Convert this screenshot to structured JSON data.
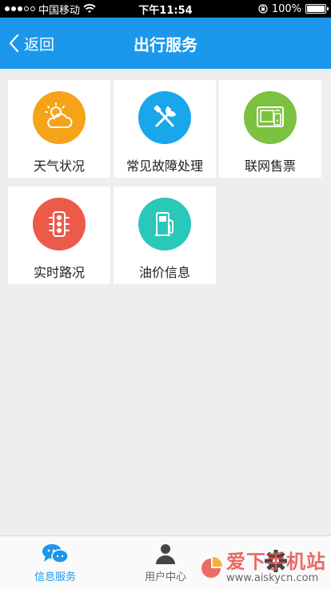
{
  "status_bar": {
    "carrier": "中国移动",
    "time": "下午11:54",
    "battery": "100%",
    "battery_level": 1.0
  },
  "nav": {
    "back_label": "返回",
    "title": "出行服务"
  },
  "tiles": [
    {
      "label": "天气状况",
      "icon": "weather-icon",
      "color": "#f5a319"
    },
    {
      "label": "常见故障处理",
      "icon": "tools-icon",
      "color": "#1aa6ea"
    },
    {
      "label": "联网售票",
      "icon": "ticket-terminal-icon",
      "color": "#7cc13f"
    },
    {
      "label": "实时路况",
      "icon": "traffic-light-icon",
      "color": "#ec5a4a"
    },
    {
      "label": "油价信息",
      "icon": "fuel-pump-icon",
      "color": "#2ac8b8"
    }
  ],
  "tabs": [
    {
      "label": "信息服务",
      "icon": "chat-bubbles-icon",
      "active": true
    },
    {
      "label": "用户中心",
      "icon": "user-icon",
      "active": false
    },
    {
      "label": "",
      "icon": "gear-icon",
      "active": false
    }
  ],
  "watermark": {
    "text": "爱下手机站",
    "url": "www.aiskycn.com"
  }
}
